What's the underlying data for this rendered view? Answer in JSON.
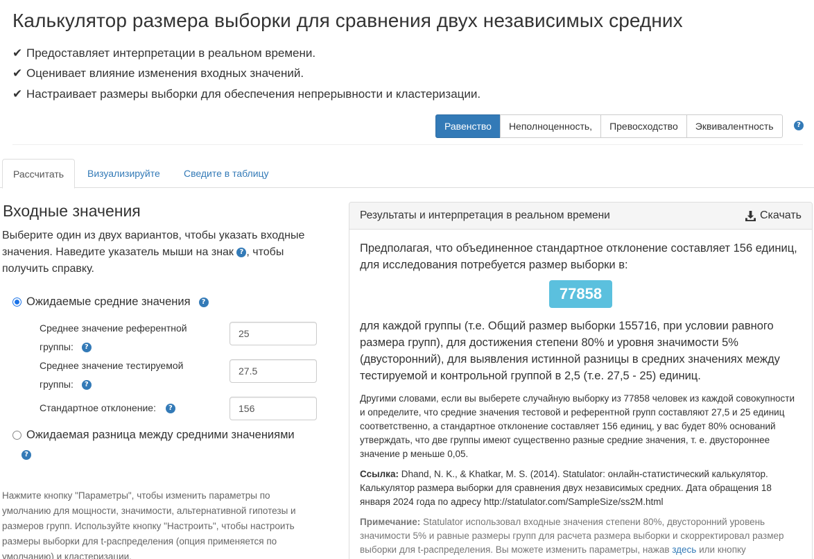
{
  "page": {
    "title": "Калькулятор размера выборки для сравнения двух независимых средних",
    "features": [
      "Предоставляет интерпретации в реальном времени.",
      "Оценивает влияние изменения входных значений.",
      "Настраивает размеры выборки для обеспечения непрерывности и кластеризации."
    ]
  },
  "hypothesis_buttons": [
    {
      "label": "Равенство",
      "active": true
    },
    {
      "label": "Неполноценность,",
      "active": false
    },
    {
      "label": "Превосходство",
      "active": false
    },
    {
      "label": "Эквивалентность",
      "active": false
    }
  ],
  "tabs": [
    {
      "label": "Рассчитать",
      "active": true
    },
    {
      "label": "Визуализируйте",
      "active": false
    },
    {
      "label": "Сведите в таблицу",
      "active": false
    }
  ],
  "inputs": {
    "title": "Входные значения",
    "desc_part1": "Выберите один из двух вариантов, чтобы указать входные значения. Наведите указатель мыши на знак",
    "desc_part2": ", чтобы получить справку.",
    "option1": "Ожидаемые средние значения",
    "option2": "Ожидаемая разница между средними значениями",
    "ref_mean_label": "Среднее значение референтной группы:",
    "ref_mean_value": "25",
    "test_mean_label": "Среднее значение тестируемой группы:",
    "test_mean_value": "27.5",
    "sd_label": "Стандартное отклонение:",
    "sd_value": "156",
    "footnote": "Нажмите кнопку \"Параметры\", чтобы изменить параметры по умолчанию для мощности, значимости, альтернативной гипотезы и размеров групп. Используйте кнопку \"Настроить\", чтобы настроить размеры выборки для t-распределения (опция применяется по умолчанию) и кластеризации."
  },
  "results": {
    "header": "Результаты и интерпретация в реальном времени",
    "download": "Скачать",
    "intro": "Предполагая, что объединенное стандартное отклонение составляет 156 единиц, для исследования потребуется размер выборки в:",
    "sample_size": "77858",
    "after": "для каждой группы (т.е. Общий размер выборки 155716, при условии равного размера групп), для достижения степени 80% и уровня значимости 5% (двусторонний), для выявления истинной разницы в средних значениях между тестируемой и контрольной группой в 2,5 (т.е. 27,5 - 25) единиц.",
    "other_words": "Другими словами, если вы выберете случайную выборку из 77858 человек из каждой совокупности и определите, что средние значения тестовой и референтной групп составляют 27,5 и 25 единиц соответственно, а стандартное отклонение составляет 156 единиц, у вас будет 80% оснований утверждать, что две группы имеют существенно разные средние значения, т. е. двустороннее значение p меньше 0,05.",
    "ref_label": "Ссылка:",
    "ref_text": "Dhand, N. K., & Khatkar, M. S. (2014). Statulator: онлайн-статистический калькулятор. Калькулятор размера выборки для сравнения двух независимых средних. Дата обращения 18 января 2024 года по адресу http://statulator.com/SampleSize/ss2M.html",
    "note_label": "Примечание:",
    "note_text": "Statulator использовал входные значения степени 80%, двусторонний уровень значимости 5% и равные размеры групп для расчета размера выборки и скорректировал размер выборки для t-распределения. Вы можете изменить параметры, нажав",
    "note_link": "здесь",
    "note_tail": "или кнопку"
  }
}
